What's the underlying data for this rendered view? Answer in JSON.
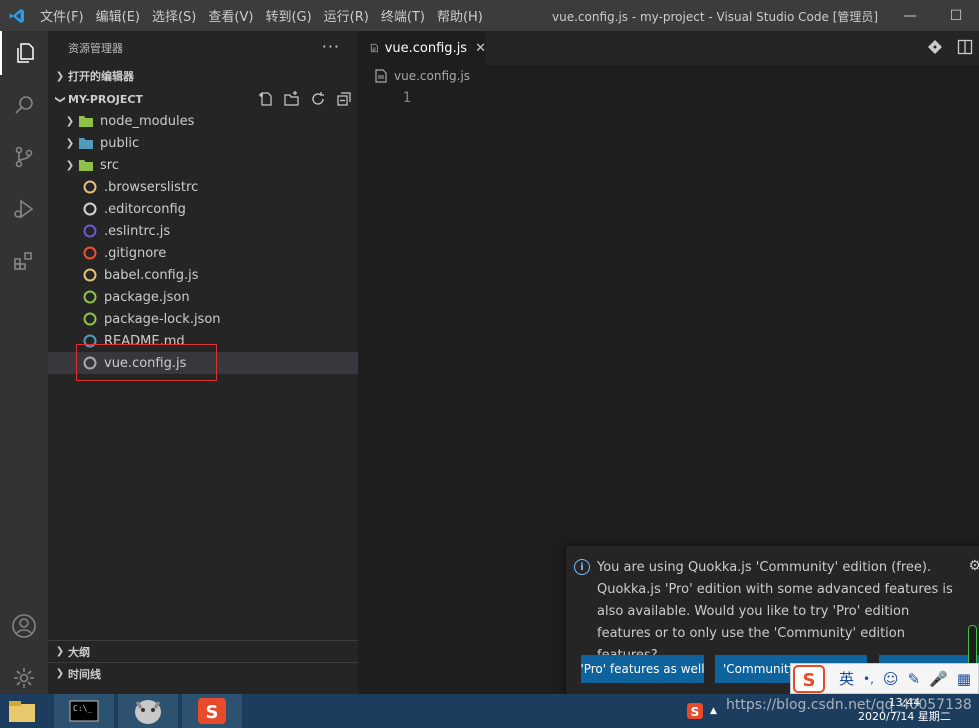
{
  "titlebar": {
    "menu": [
      "文件(F)",
      "编辑(E)",
      "选择(S)",
      "查看(V)",
      "转到(G)",
      "运行(R)",
      "终端(T)",
      "帮助(H)"
    ],
    "window_title": "vue.config.js - my-project - Visual Studio Code [管理员]"
  },
  "sidebar": {
    "header": "资源管理器",
    "open_editors": "打开的编辑器",
    "project": "MY-PROJECT",
    "items": [
      {
        "label": "node_modules",
        "type": "folder",
        "icon_color": "#8dc149"
      },
      {
        "label": "public",
        "type": "folder",
        "icon_color": "#519aba"
      },
      {
        "label": "src",
        "type": "folder",
        "icon_color": "#8dc149"
      },
      {
        "label": ".browserslistrc",
        "type": "file",
        "icon_color": "#e5c07b"
      },
      {
        "label": ".editorconfig",
        "type": "file",
        "icon_color": "#d4d4d4"
      },
      {
        "label": ".eslintrc.js",
        "type": "file",
        "icon_color": "#6a5acd"
      },
      {
        "label": ".gitignore",
        "type": "file",
        "icon_color": "#f05133"
      },
      {
        "label": "babel.config.js",
        "type": "file",
        "icon_color": "#e5c07b"
      },
      {
        "label": "package.json",
        "type": "file",
        "icon_color": "#8dc149"
      },
      {
        "label": "package-lock.json",
        "type": "file",
        "icon_color": "#8dc149"
      },
      {
        "label": "README.md",
        "type": "file",
        "icon_color": "#519aba"
      },
      {
        "label": "vue.config.js",
        "type": "file",
        "icon_color": "#a9a9a9"
      }
    ],
    "outline": "大纲",
    "timeline": "时间线"
  },
  "editor": {
    "tab_label": "vue.config.js",
    "breadcrumb": "vue.config.js",
    "line_number": "1"
  },
  "notification": {
    "message": "You are using Quokka.js 'Community' edition (free). Quokka.js 'Pro' edition with some advanced features is also available. Would you like to try 'Pro' edition features or to only use the 'Community' edition features?",
    "btn_pro": "'Pro' features as well",
    "btn_community": "'Community"
  },
  "ime": {
    "lang": "英"
  },
  "taskbar": {
    "url_watermark": "https://blog.csdn.net/qq_40057138",
    "time": "13:44",
    "date": "2020/7/14 星期二"
  },
  "colors": {
    "accent": "#0e639c",
    "selection": "#37373d",
    "highlight_box": "#e03030"
  }
}
